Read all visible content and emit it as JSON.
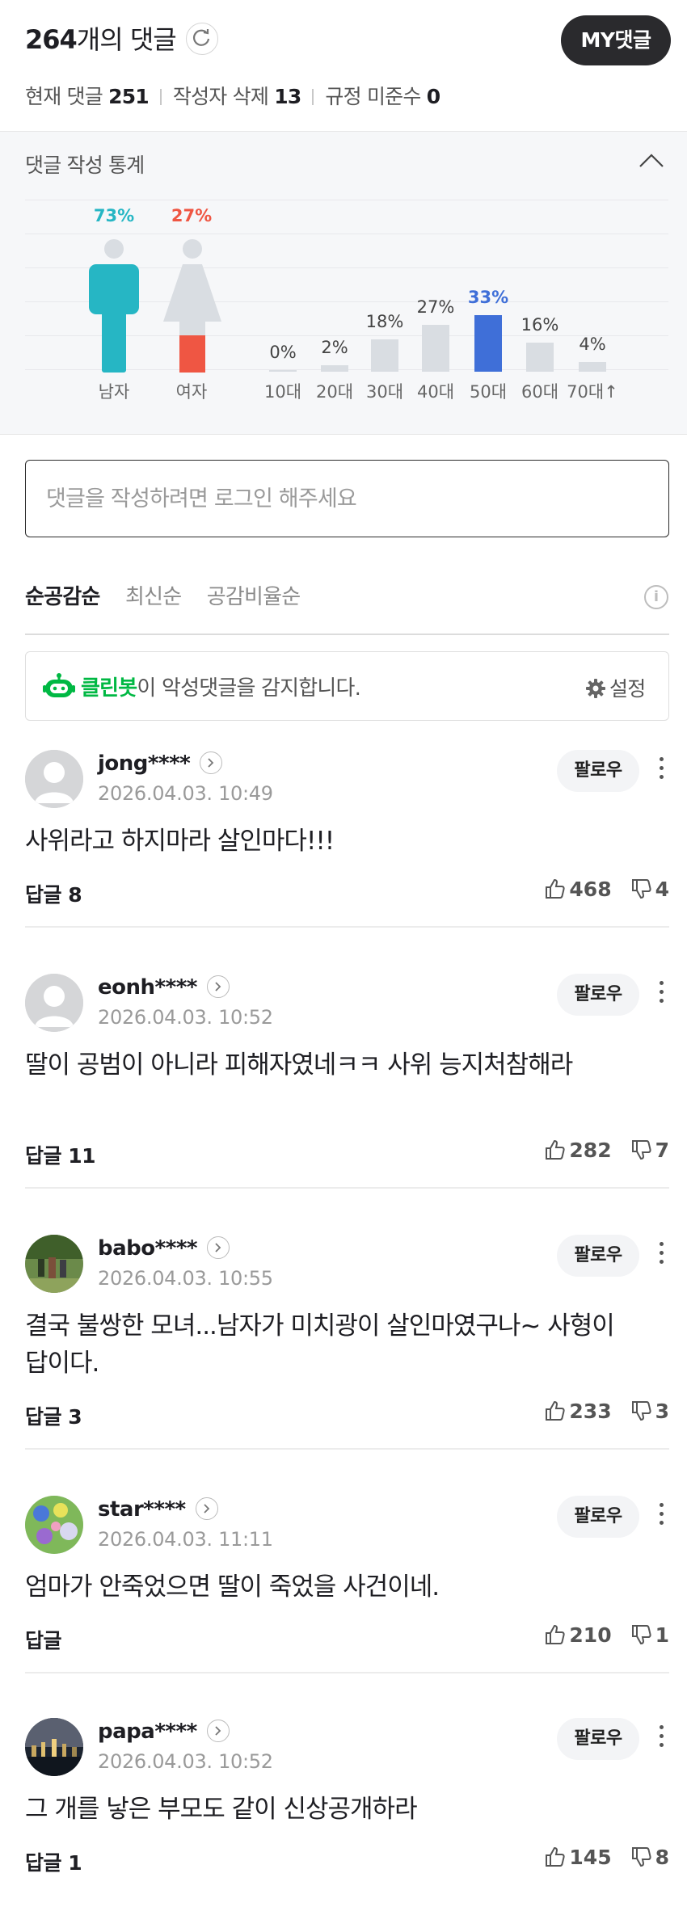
{
  "header": {
    "comment_count": "264",
    "comment_count_unit": "개의 댓글",
    "my_button": "MY댓글",
    "current_label": "현재 댓글",
    "current_value": "251",
    "deleted_label": "작성자 삭제",
    "deleted_value": "13",
    "violation_label": "규정 미준수",
    "violation_value": "0"
  },
  "stats": {
    "title": "댓글 작성 통계",
    "gender": [
      {
        "label": "남자",
        "percent": "73%",
        "color": "#26b6c4"
      },
      {
        "label": "여자",
        "percent": "27%",
        "color": "#ef5643"
      }
    ],
    "ages": [
      {
        "label": "10대",
        "percent": "0%",
        "value": 0
      },
      {
        "label": "20대",
        "percent": "2%",
        "value": 2
      },
      {
        "label": "30대",
        "percent": "18%",
        "value": 18
      },
      {
        "label": "40대",
        "percent": "27%",
        "value": 27
      },
      {
        "label": "50대",
        "percent": "33%",
        "value": 33,
        "highlight": true
      },
      {
        "label": "60대",
        "percent": "16%",
        "value": 16
      },
      {
        "label": "70대↑",
        "percent": "4%",
        "value": 4
      }
    ]
  },
  "input": {
    "placeholder": "댓글을 작성하려면 로그인 해주세요"
  },
  "sort": {
    "tabs": [
      "순공감순",
      "최신순",
      "공감비율순"
    ],
    "active": 0
  },
  "cleanbot": {
    "name": "클린봇",
    "message": "이 악성댓글을 감지합니다.",
    "setting": "설정"
  },
  "comments": [
    {
      "nick": "jong****",
      "date": "2026.04.03. 10:49",
      "text": "사위라고 하지마라 살인마다!!!",
      "reply": "답글 8",
      "likes": "468",
      "dislikes": "4",
      "follow": "팔로우",
      "avatar": "default"
    },
    {
      "nick": "eonh****",
      "date": "2026.04.03. 10:52",
      "text": "딸이 공범이 아니라 피해자였네ㅋㅋ 사위 능지처참해라",
      "reply": "답글 11",
      "likes": "282",
      "dislikes": "7",
      "follow": "팔로우",
      "avatar": "default"
    },
    {
      "nick": "babo****",
      "date": "2026.04.03. 10:55",
      "text": "결국 불쌍한 모녀...남자가 미치광이 살인마였구나~ 사형이 답이다.",
      "reply": "답글 3",
      "likes": "233",
      "dislikes": "3",
      "follow": "팔로우",
      "avatar": "photo-people"
    },
    {
      "nick": "star****",
      "date": "2026.04.03. 11:11",
      "text": "엄마가 안죽었으면 딸이 죽었을 사건이네.",
      "reply": "답글",
      "likes": "210",
      "dislikes": "1",
      "follow": "팔로우",
      "avatar": "photo-flowers"
    },
    {
      "nick": "papa****",
      "date": "2026.04.03. 10:52",
      "text": "그 개를 낳은 부모도 같이 신상공개하라",
      "reply": "답글 1",
      "likes": "145",
      "dislikes": "8",
      "follow": "팔로우",
      "avatar": "photo-night"
    }
  ]
}
